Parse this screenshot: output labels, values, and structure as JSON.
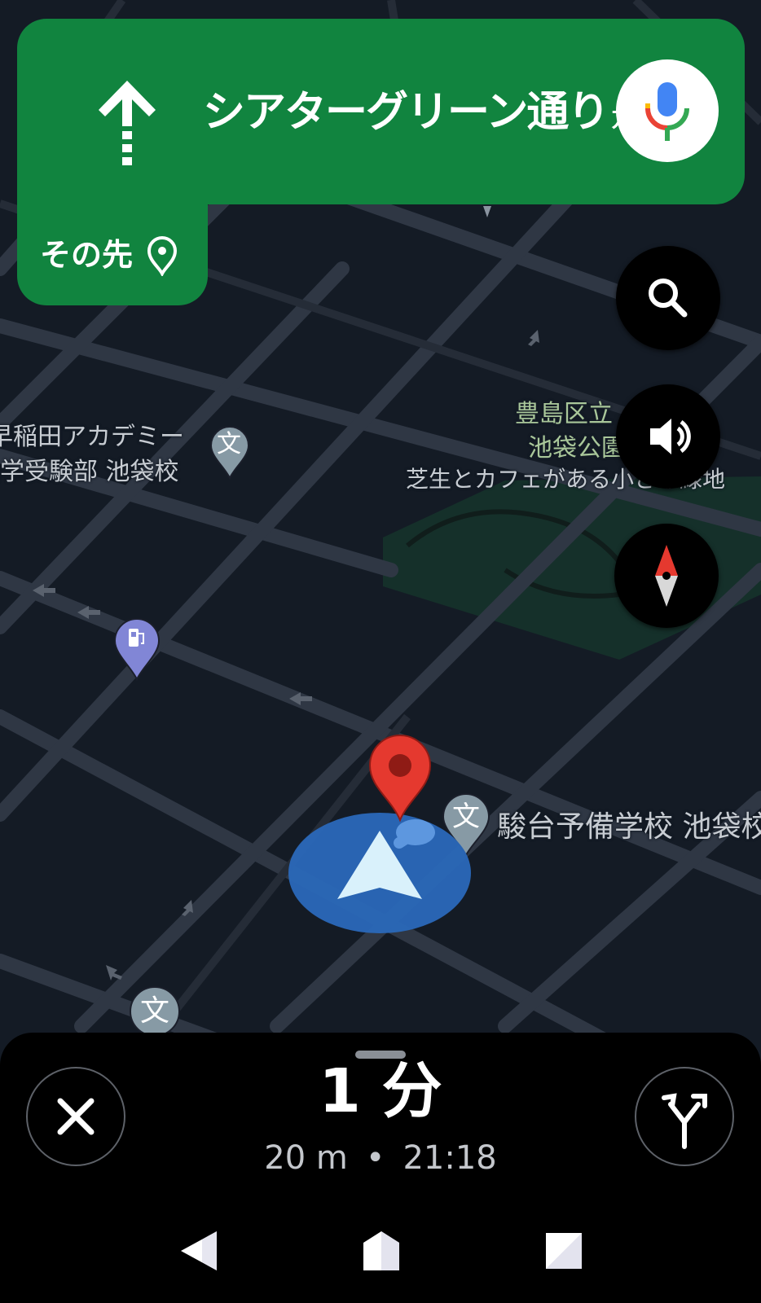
{
  "banner": {
    "street": "シアターグリーン通り",
    "suffix": "方面",
    "then_label": "その先"
  },
  "map": {
    "labels": {
      "academy_line1": "早稲田アカデミー",
      "academy_line2": "大学受験部 池袋校",
      "park_line1": "豊島区立",
      "park_line2": "池袋公園",
      "park_line3": "芝生とカフェがある小さな緑地",
      "school": "駿台予備学校 池袋校"
    },
    "icons": {
      "school_glyph": "文"
    }
  },
  "trip": {
    "duration": "1 分",
    "distance": "20 m",
    "separator": "•",
    "arrival": "21:18"
  },
  "colors": {
    "banner_green": "#11843f",
    "map_bg": "#141b25",
    "road": "#2f3744",
    "park": "#15302a",
    "location_blue": "#2a68b9",
    "pin_red": "#e5392f"
  }
}
